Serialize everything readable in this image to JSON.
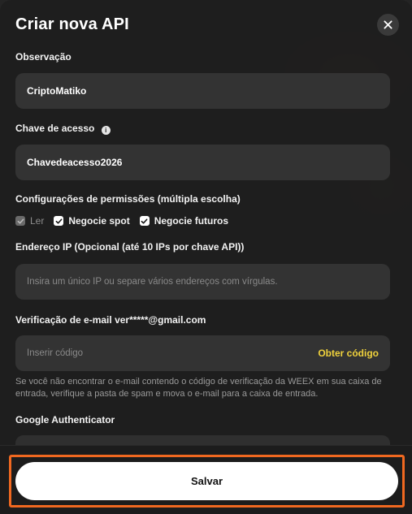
{
  "dialog": {
    "title": "Criar nova API"
  },
  "fields": {
    "observacao": {
      "label": "Observação",
      "value": "CriptoMatiko"
    },
    "chave_acesso": {
      "label": "Chave de acesso",
      "value": "Chavedeacesso2026"
    },
    "permissoes": {
      "label": "Configurações de permissões (múltipla escolha)",
      "options": [
        {
          "label": "Ler",
          "checked": true,
          "disabled": true
        },
        {
          "label": "Negocie spot",
          "checked": true,
          "disabled": false
        },
        {
          "label": "Negocie futuros",
          "checked": true,
          "disabled": false
        }
      ]
    },
    "ip": {
      "label": "Endereço IP (Opcional (até 10 IPs por chave API))",
      "placeholder": "Insira um único IP ou separe vários endereços com vírgulas."
    },
    "email": {
      "label": "Verificação de e-mail ver*****@gmail.com",
      "placeholder": "Inserir código",
      "get_code": "Obter código",
      "note": "Se você não encontrar o e-mail contendo o código de verificação da WEEX em sua caixa de entrada, verifique a pasta de spam e mova o e-mail para a caixa de entrada."
    },
    "google": {
      "label": "Google Authenticator"
    }
  },
  "footer": {
    "save_label": "Salvar"
  },
  "colors": {
    "accent_link": "#f0d23c",
    "highlight": "#f06820"
  },
  "icons": {
    "close": "close-icon",
    "info": "info-icon",
    "check": "check-icon"
  }
}
